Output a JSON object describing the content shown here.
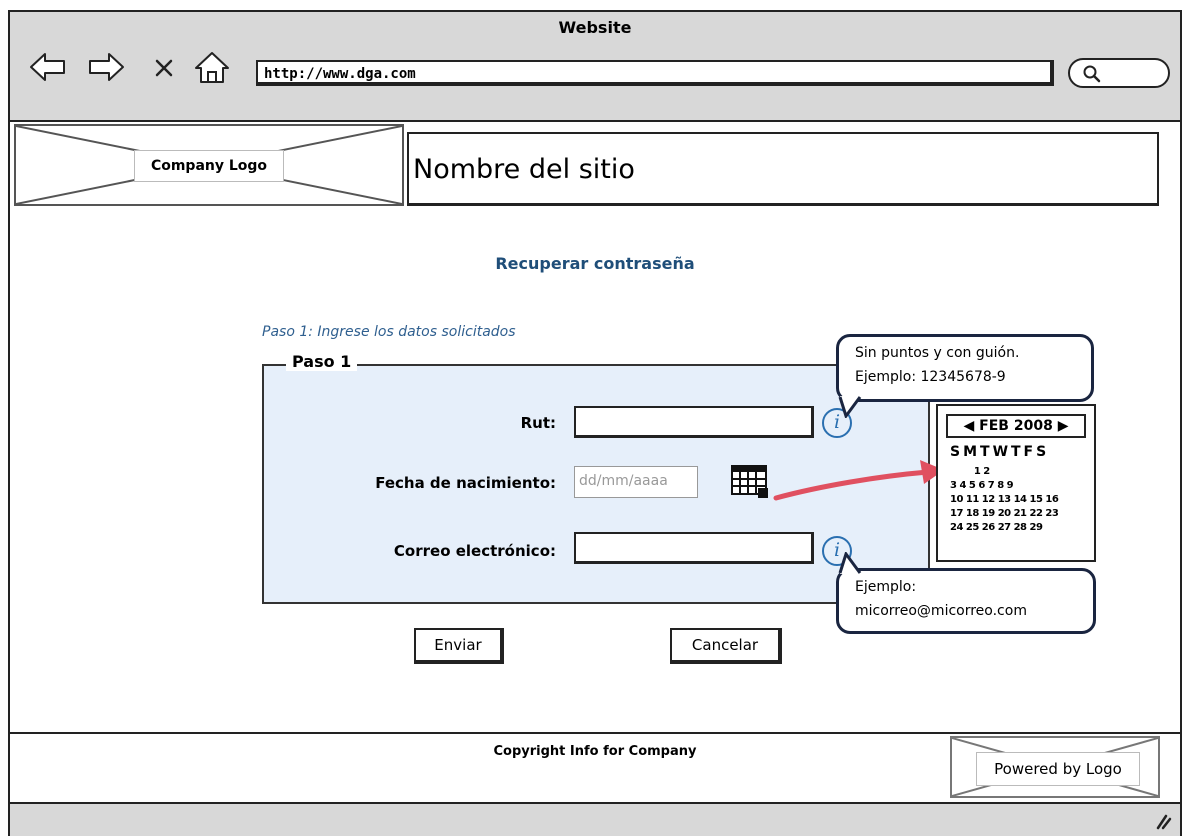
{
  "browser": {
    "window_title": "Website",
    "url": "http://www.dga.com",
    "nav_icons": [
      "back-arrow-icon",
      "forward-arrow-icon",
      "close-icon",
      "home-icon"
    ],
    "search_icon": "search-icon"
  },
  "header": {
    "logo_label": "Company Logo",
    "site_name": "Nombre del sitio"
  },
  "main": {
    "heading": "Recuperar contraseña",
    "step_hint": "Paso 1: Ingrese los datos solicitados",
    "fieldset_legend": "Paso 1",
    "rut_label": "Rut:",
    "birthdate_label": "Fecha de nacimiento:",
    "birthdate_placeholder": "dd/mm/aaaa",
    "email_label": "Correo electrónico:",
    "rut_tooltip_line1": "Sin puntos y con guión.",
    "rut_tooltip_line2": "Ejemplo: 12345678-9",
    "email_tooltip_line1": "Ejemplo:",
    "email_tooltip_line2": "micorreo@micorreo.com",
    "info_icon_glyph": "i",
    "submit_label": "Enviar",
    "cancel_label": "Cancelar"
  },
  "calendar": {
    "month_label": "FEB 2008",
    "day_headers": "SMTWTFS",
    "rows": [
      "        1 2",
      "3 4 5 6 7 8 9",
      "10 11 12 13 14 15 16",
      "17 18 19 20 21 22 23",
      "24 25 26 27 28 29"
    ]
  },
  "footer": {
    "copyright": "Copyright Info for Company",
    "powered_label": "Powered by Logo"
  },
  "colors": {
    "accent_text": "#1f4e79",
    "form_bg": "#e6effa",
    "info_icon": "#2a6fb0",
    "arrow": "#e05060",
    "chrome_bg": "#d8d8d8"
  }
}
